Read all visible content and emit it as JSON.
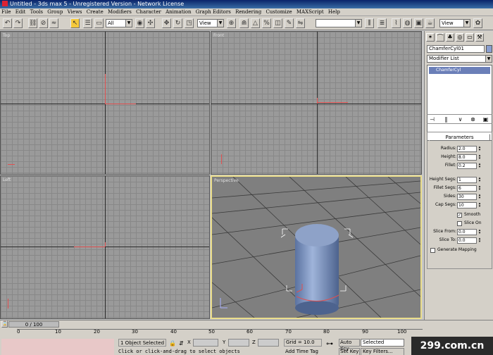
{
  "window": {
    "title": "Untitled - 3ds max 5 - Unregistered Version - Network License"
  },
  "menu": [
    "File",
    "Edit",
    "Tools",
    "Group",
    "Views",
    "Create",
    "Modifiers",
    "Character",
    "Animation",
    "Graph Editors",
    "Rendering",
    "Customize",
    "MAXScript",
    "Help"
  ],
  "toolbar": {
    "selection_filter": "All",
    "ref_coord": "View",
    "named_selection": "",
    "view_combo": "View"
  },
  "viewports": {
    "top": "Top",
    "front": "Front",
    "left": "Left",
    "perspective": "Perspective"
  },
  "command_panel": {
    "object_name": "ChamferCyl01",
    "modifier_list": "Modifier List",
    "stack_item": "ChamferCyl",
    "rollout_title": "Parameters",
    "params": [
      {
        "label": "Radius:",
        "value": "2.0"
      },
      {
        "label": "Height:",
        "value": "8.0"
      },
      {
        "label": "Fillet:",
        "value": "0.2"
      },
      {
        "label": "Height Segs:",
        "value": "1"
      },
      {
        "label": "Fillet Segs:",
        "value": "6"
      },
      {
        "label": "Sides:",
        "value": "30"
      },
      {
        "label": "Cap Segs:",
        "value": "10"
      }
    ],
    "smooth_label": "Smooth",
    "slice_on_label": "Slice On",
    "slice_params": [
      {
        "label": "Slice From:",
        "value": "0.0"
      },
      {
        "label": "Slice To:",
        "value": "0.0"
      }
    ],
    "gen_mapping_label": "Generate Mapping",
    "smooth_checked": true,
    "slice_on_checked": false,
    "gen_mapping_checked": false
  },
  "timeline": {
    "slider_label": "0 / 100",
    "ticks": [
      "0",
      "10",
      "20",
      "30",
      "40",
      "50",
      "60",
      "70",
      "80",
      "90",
      "100"
    ]
  },
  "status": {
    "selected": "1 Object Selected",
    "prompt": "Click or click-and-drag to select objects",
    "x_label": "X",
    "y_label": "Y",
    "z_label": "Z",
    "grid": "Grid = 10.0",
    "add_time_tag": "Add Time Tag",
    "auto_key": "Auto Key",
    "set_key": "Set Key",
    "selected_combo": "Selected",
    "key_filters": "Key Filters..."
  },
  "watermark": "299.com.cn",
  "colors": {
    "object_color": "#8a9fd0",
    "titlebar": "#0a246a",
    "active_viewport_border": "#e9dc8a",
    "cylinder": "#6e88b8"
  }
}
